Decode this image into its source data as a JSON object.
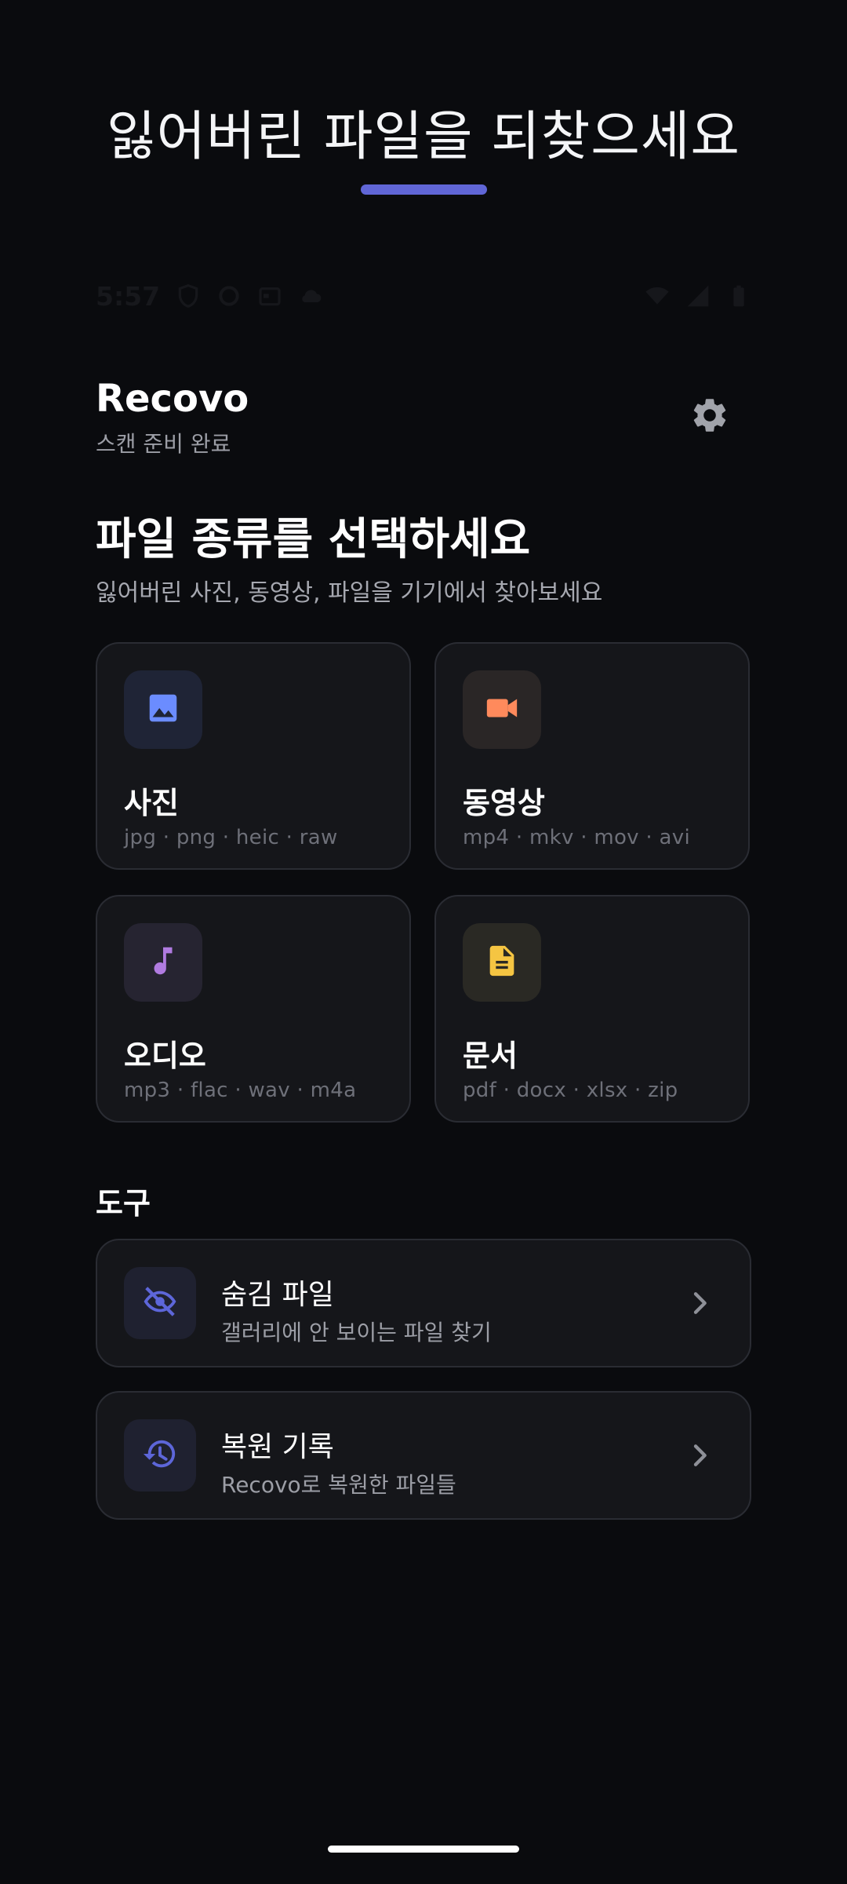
{
  "promo": {
    "title": "잃어버린 파일을 되찾으세요",
    "accent_color": "#6066d6"
  },
  "status_bar": {
    "time": "5:57",
    "icons": [
      "shield-icon",
      "sync-icon",
      "calendar-icon",
      "cloud-icon",
      "wifi-icon",
      "signal-icon",
      "battery-icon"
    ]
  },
  "app": {
    "name": "Recovo",
    "status": "스캔 준비 완료",
    "settings_icon": "gear-icon"
  },
  "main": {
    "heading": "파일 종류를 선택하세요",
    "description": "잃어버린 사진, 동영상, 파일을 기기에서 찾아보세요",
    "file_types": [
      {
        "label": "사진",
        "formats": "jpg · png · heic · raw",
        "icon": "image-icon",
        "color": "#6b8cff"
      },
      {
        "label": "동영상",
        "formats": "mp4 · mkv · mov · avi",
        "icon": "video-camera-icon",
        "color": "#ff8a5c"
      },
      {
        "label": "오디오",
        "formats": "mp3 · flac · wav · m4a",
        "icon": "music-note-icon",
        "color": "#b07be0"
      },
      {
        "label": "문서",
        "formats": "pdf · docx · xlsx · zip",
        "icon": "document-icon",
        "color": "#f5c542"
      }
    ]
  },
  "tools": {
    "heading": "도구",
    "items": [
      {
        "title": "숨김 파일",
        "subtitle": "갤러리에 안 보이는 파일 찾기",
        "icon": "eye-off-icon"
      },
      {
        "title": "복원 기록",
        "subtitle": "Recovo로 복원한 파일들",
        "icon": "history-icon"
      }
    ]
  }
}
